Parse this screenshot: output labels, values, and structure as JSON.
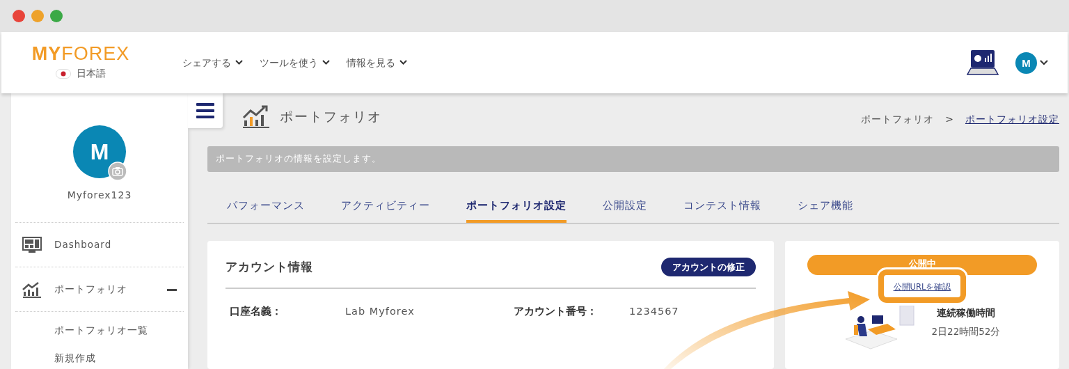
{
  "header": {
    "logo": {
      "my": "MY",
      "forex": "FOREX"
    },
    "language": "日本語",
    "menus": [
      {
        "label": "シェアする"
      },
      {
        "label": "ツールを使う"
      },
      {
        "label": "情報を見る"
      }
    ],
    "avatar": "M"
  },
  "sidebar": {
    "avatar": "M",
    "username": "Myforex123",
    "items": [
      {
        "label": "Dashboard",
        "kind": "dashboard"
      },
      {
        "label": "ポートフォリオ",
        "kind": "portfolio",
        "expanded": true,
        "children": [
          {
            "label": "ポートフォリオ一覧"
          },
          {
            "label": "新規作成"
          }
        ]
      }
    ]
  },
  "page": {
    "title": "ポートフォリオ",
    "breadcrumb": [
      {
        "label": "ポートフォリオ",
        "link": false
      },
      {
        "label": "ポートフォリオ設定",
        "link": true
      }
    ],
    "breadcrumb_separator": ">",
    "notice": "ポートフォリオの情報を設定します。"
  },
  "tabs": [
    {
      "label": "パフォーマンス",
      "selected": false
    },
    {
      "label": "アクティビティー",
      "selected": false
    },
    {
      "label": "ポートフォリオ設定",
      "selected": true
    },
    {
      "label": "公開設定",
      "selected": false
    },
    {
      "label": "コンテスト情報",
      "selected": false
    },
    {
      "label": "シェア機能",
      "selected": false
    }
  ],
  "account_card": {
    "title": "アカウント情報",
    "edit_button": "アカウントの修正",
    "fields": [
      {
        "label": "口座名義：",
        "value": "Lab Myforex"
      },
      {
        "label": "アカウント番号：",
        "value": "1234567"
      }
    ]
  },
  "status_card": {
    "status": "公開中",
    "url_link": "公開URLを確認",
    "uptime_label": "連続稼働時間",
    "uptime": "2日22時間52分"
  }
}
